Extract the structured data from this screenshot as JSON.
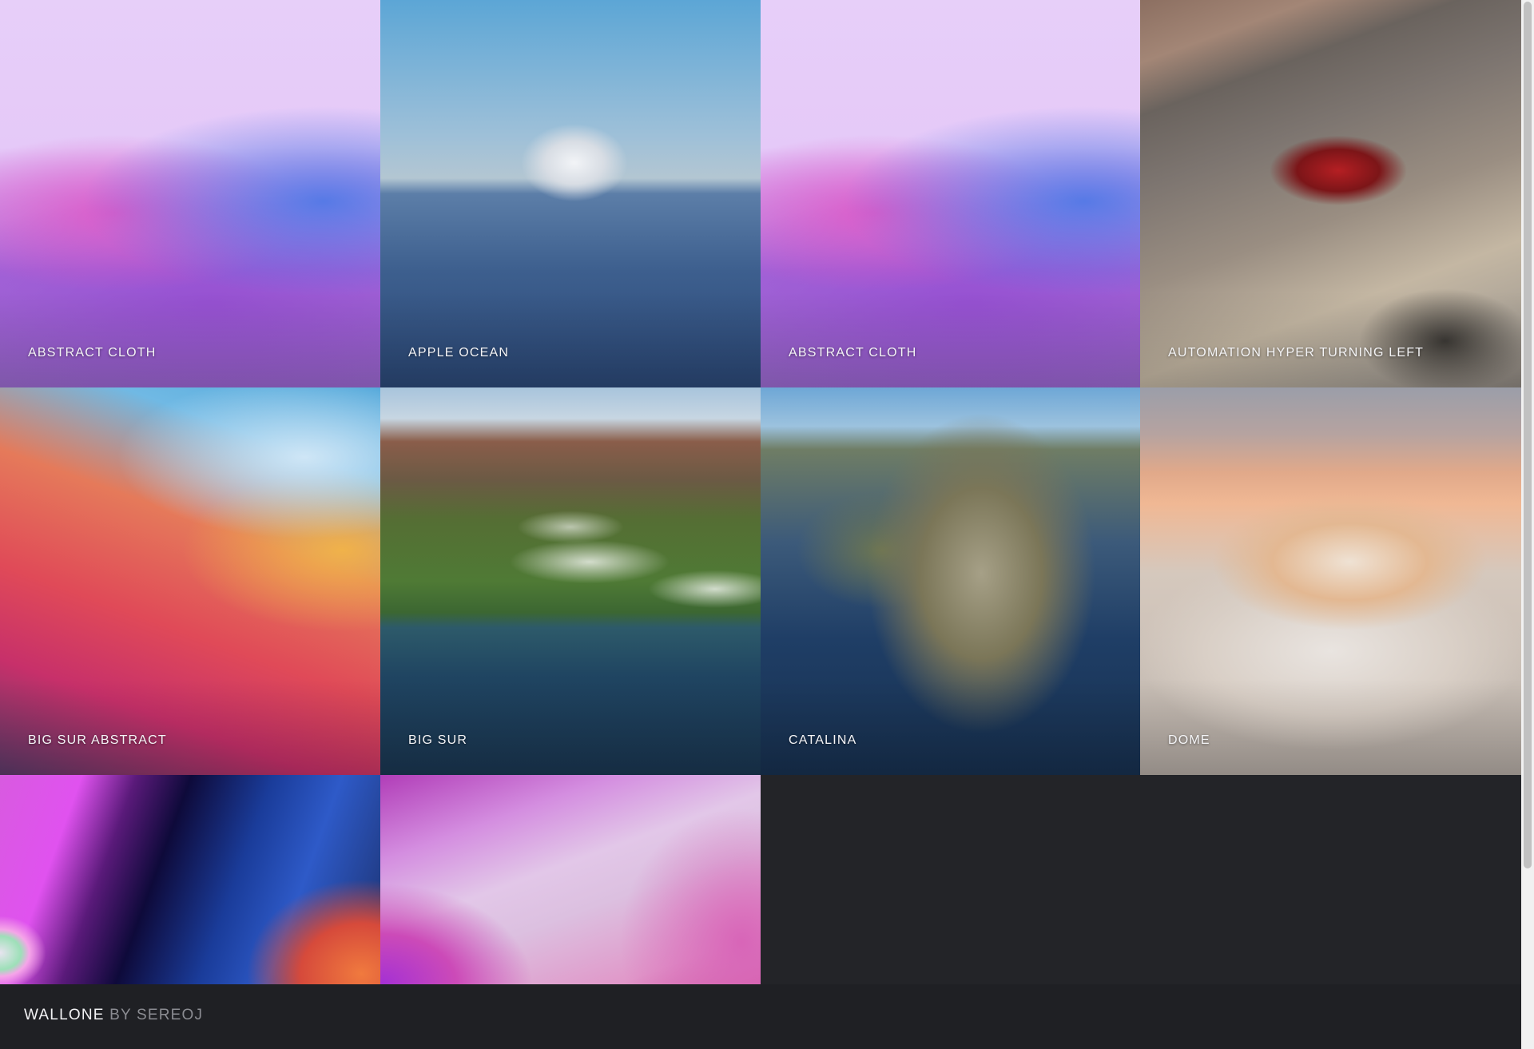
{
  "gallery": {
    "tiles": [
      {
        "caption": "Abstract Cloth"
      },
      {
        "caption": "Apple Ocean"
      },
      {
        "caption": "Abstract Cloth"
      },
      {
        "caption": "Automation Hyper Turning Left"
      },
      {
        "caption": "Big Sur Abstract"
      },
      {
        "caption": "Big Sur"
      },
      {
        "caption": "Catalina"
      },
      {
        "caption": "Dome"
      },
      {
        "caption": ""
      },
      {
        "caption": ""
      }
    ]
  },
  "footer": {
    "brand_name": "WALLONE",
    "brand_by": "BY SEREOJ"
  },
  "colors": {
    "background": "#232428",
    "footer": "#1f2024",
    "caption_text": "#f4f4f6",
    "brand_secondary": "#8b8c92"
  }
}
